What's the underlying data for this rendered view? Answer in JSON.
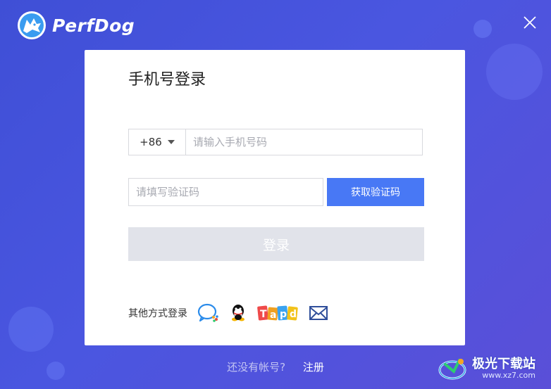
{
  "app": {
    "name": "PerfDog"
  },
  "login": {
    "title": "手机号登录",
    "country_code": "+86",
    "phone_placeholder": "请输入手机号码",
    "code_placeholder": "请填写验证码",
    "get_code_label": "获取验证码",
    "submit_label": "登录",
    "other_methods_label": "其他方式登录",
    "social_icons": [
      "wechat-work-icon",
      "qq-icon",
      "tapd-icon",
      "mail-icon"
    ]
  },
  "footer": {
    "no_account": "还没有帐号?",
    "register": "注册"
  },
  "watermark": {
    "name": "极光下载站",
    "url": "www.xz7.com"
  },
  "colors": {
    "background": "#4450db",
    "primary": "#4878f5",
    "disabled": "#e1e3ea"
  }
}
